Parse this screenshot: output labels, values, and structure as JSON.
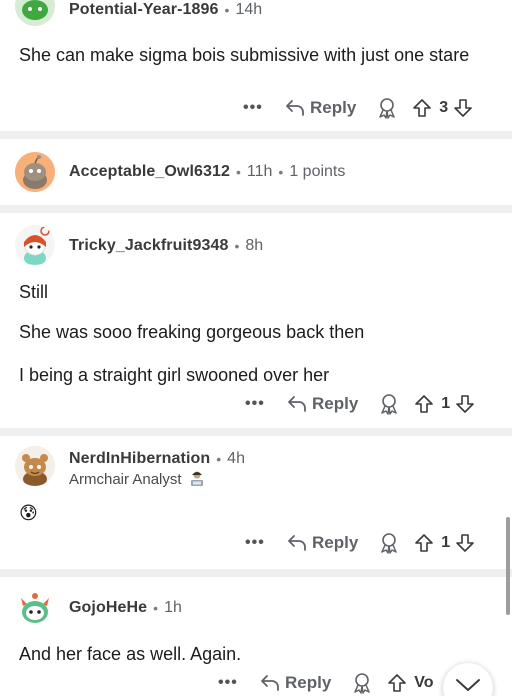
{
  "comments": [
    {
      "username": "Potential-Year-1896",
      "time": "14h",
      "body": [
        "She can make sigma bois submissive with just one stare"
      ],
      "actions": {
        "more": "•••",
        "reply": "Reply",
        "score": "3"
      }
    },
    {
      "username": "Acceptable_Owl6312",
      "time": "11h",
      "points": "1 points"
    },
    {
      "username": "Tricky_Jackfruit9348",
      "time": "8h",
      "body": [
        "Still",
        "She was sooo freaking gorgeous back then",
        "I being a straight girl swooned over her"
      ],
      "actions": {
        "more": "•••",
        "reply": "Reply",
        "score": "1"
      }
    },
    {
      "username": "NerdInHibernation",
      "time": "4h",
      "flair": "Armchair Analyst",
      "body_emoji": "😰",
      "actions": {
        "more": "•••",
        "reply": "Reply",
        "score": "1"
      }
    },
    {
      "username": "GojoHeHe",
      "time": "1h",
      "body": [
        "And her face as well. Again."
      ],
      "actions": {
        "more": "•••",
        "reply": "Reply",
        "vote_label": "Vo"
      }
    }
  ],
  "separator_dot": "•",
  "icons": {
    "reply": "reply-arrow-icon",
    "award": "award-icon",
    "upvote": "upvote-icon",
    "downvote": "downvote-icon",
    "jump": "chevron-down-icon"
  },
  "colors": {
    "separator": "#eeeff1",
    "text": "#1c1c1c",
    "muted": "#5f6368"
  }
}
